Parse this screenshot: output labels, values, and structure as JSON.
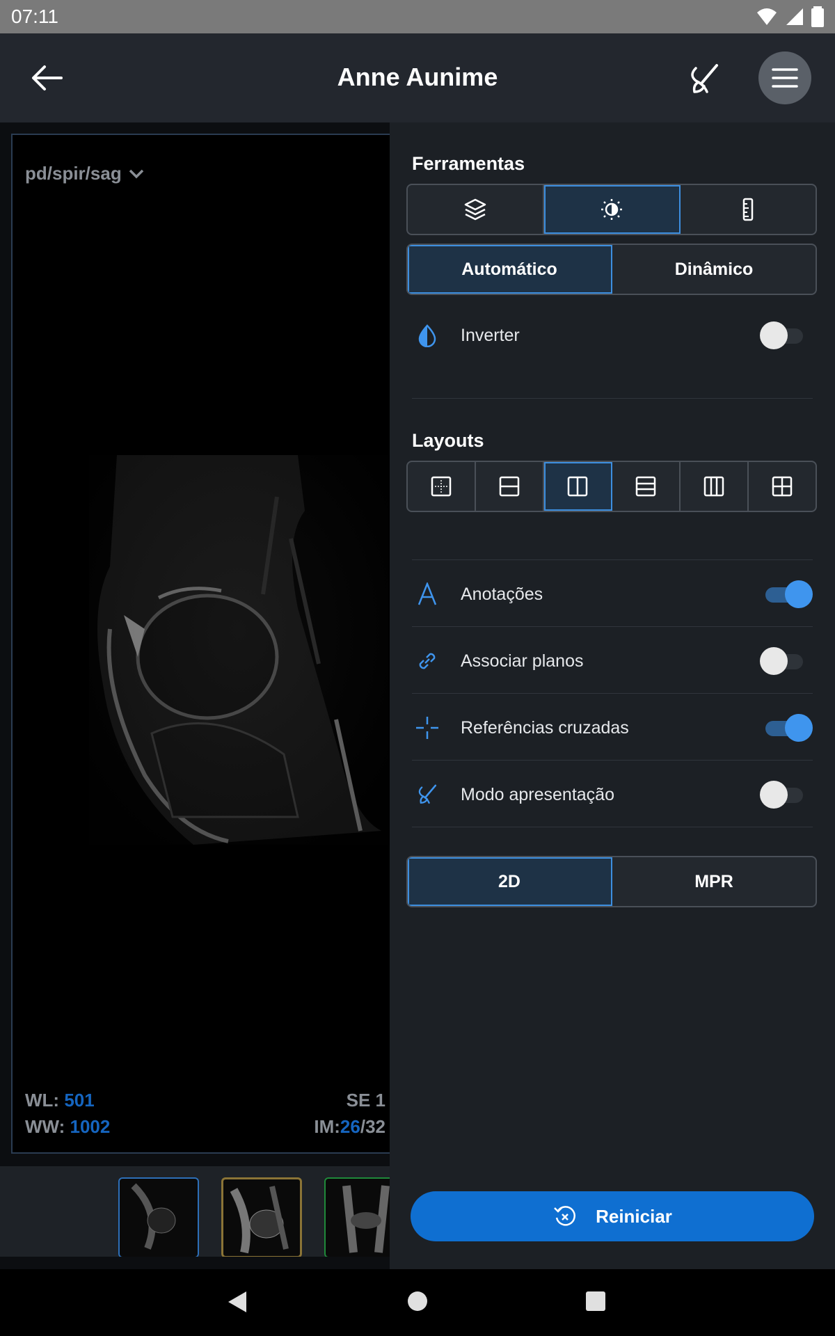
{
  "status": {
    "time": "07:11"
  },
  "header": {
    "title": "Anne Aunime"
  },
  "viewer": {
    "series_label": "pd/spir/sag",
    "wl_label": "WL:",
    "wl_value": "501",
    "ww_label": "WW:",
    "ww_value": "1002",
    "se_label": "SE",
    "se_value": "1",
    "im_label": "IM:",
    "im_value": "26",
    "im_total": "/32"
  },
  "panel": {
    "tools_title": "Ferramentas",
    "tool_tabs": [
      "layers-icon",
      "brightness-icon",
      "ruler-icon"
    ],
    "mode_options": [
      "Automático",
      "Dinâmico"
    ],
    "invert_label": "Inverter",
    "layouts_title": "Layouts",
    "toggles": {
      "annotations": "Anotações",
      "link_planes": "Associar planos",
      "cross_references": "Referências cruzadas",
      "presentation_mode": "Modo apresentação"
    },
    "view_options": [
      "2D",
      "MPR"
    ],
    "reset_label": "Reiniciar"
  },
  "state": {
    "invert": false,
    "annotations": true,
    "link_planes": false,
    "cross_references": true,
    "presentation_mode": false,
    "active_tool_tab": 1,
    "active_mode": "Automático",
    "active_layout": 2,
    "active_view": "2D"
  },
  "colors": {
    "accent": "#3f95ee",
    "primary_button": "#0f6fd1",
    "panel_bg": "#1c2025"
  }
}
